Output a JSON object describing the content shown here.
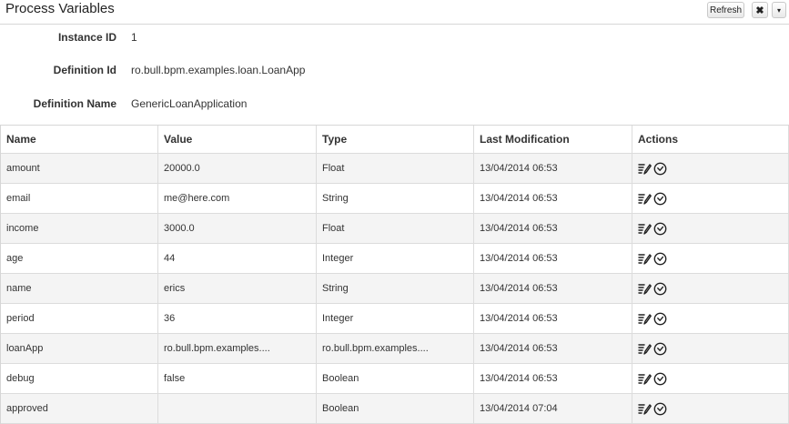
{
  "window": {
    "title": "Process Variables",
    "refresh_label": "Refresh",
    "close_label": "✖",
    "menu_label": "▾"
  },
  "info": {
    "instance_id_label": "Instance ID",
    "instance_id": "1",
    "definition_id_label": "Definition Id",
    "definition_id": "ro.bull.bpm.examples.loan.LoanApp",
    "definition_name_label": "Definition Name",
    "definition_name": "GenericLoanApplication"
  },
  "table": {
    "columns": [
      "Name",
      "Value",
      "Type",
      "Last Modification",
      "Actions"
    ],
    "rows": [
      {
        "name": "amount",
        "value": "20000.0",
        "type": "Float",
        "modified": "13/04/2014 06:53"
      },
      {
        "name": "email",
        "value": "me@here.com",
        "type": "String",
        "modified": "13/04/2014 06:53"
      },
      {
        "name": "income",
        "value": "3000.0",
        "type": "Float",
        "modified": "13/04/2014 06:53"
      },
      {
        "name": "age",
        "value": "44",
        "type": "Integer",
        "modified": "13/04/2014 06:53"
      },
      {
        "name": "name",
        "value": "erics",
        "type": "String",
        "modified": "13/04/2014 06:53"
      },
      {
        "name": "period",
        "value": "36",
        "type": "Integer",
        "modified": "13/04/2014 06:53"
      },
      {
        "name": "loanApp",
        "value": "ro.bull.bpm.examples....",
        "type": "ro.bull.bpm.examples....",
        "modified": "13/04/2014 06:53"
      },
      {
        "name": "debug",
        "value": "false",
        "type": "Boolean",
        "modified": "13/04/2014 06:53"
      },
      {
        "name": "approved",
        "value": "",
        "type": "Boolean",
        "modified": "13/04/2014 07:04"
      }
    ],
    "action_icons": [
      "edit-icon",
      "history-icon"
    ]
  }
}
